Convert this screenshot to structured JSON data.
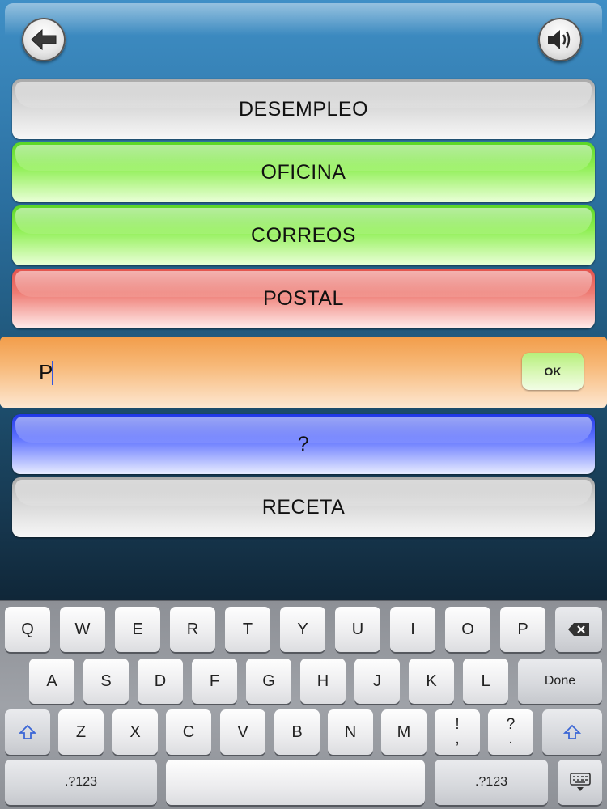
{
  "header": {
    "back_icon": "arrow-left-icon",
    "sound_icon": "speaker-icon"
  },
  "words_top": [
    "DESEMPLEO",
    "OFICINA",
    "CORREOS",
    "POSTAL"
  ],
  "answer": {
    "value": "P",
    "ok_label": "OK"
  },
  "words_bottom": [
    "?",
    "RECETA"
  ],
  "colors": {
    "gray": "#d6d6d6",
    "green": "#8eef52",
    "red": "#ee7b73",
    "blue": "#5f72ff",
    "input_bar": "#f7b877"
  },
  "keyboard": {
    "row1": [
      "Q",
      "W",
      "E",
      "R",
      "T",
      "Y",
      "U",
      "I",
      "O",
      "P"
    ],
    "row2": [
      "A",
      "S",
      "D",
      "F",
      "G",
      "H",
      "J",
      "K",
      "L"
    ],
    "done_label": "Done",
    "row3": [
      "Z",
      "X",
      "C",
      "V",
      "B",
      "N",
      "M"
    ],
    "excl_top": "!",
    "excl_bottom": ",",
    "quest_top": "?",
    "quest_bottom": ".",
    "numbers_label": ".?123",
    "backspace_icon": "backspace-icon",
    "shift_icon": "shift-icon",
    "hide_keyboard_icon": "keyboard-hide-icon"
  }
}
